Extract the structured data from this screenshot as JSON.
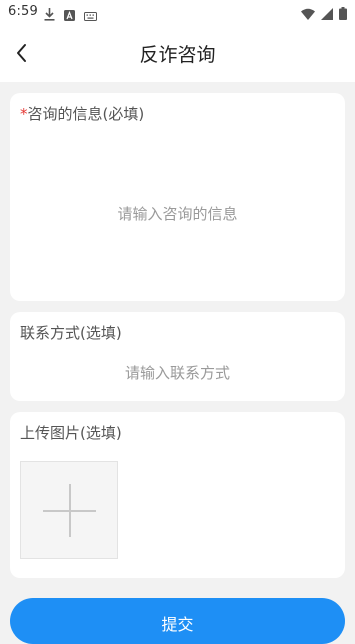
{
  "status_bar": {
    "time": "6:59",
    "icons": [
      "download-icon",
      "text-a-icon",
      "keyboard-icon",
      "wifi-icon",
      "signal-icon",
      "battery-icon"
    ]
  },
  "header": {
    "back_icon": "chevron-left-icon",
    "title": "反诈咨询"
  },
  "form": {
    "info": {
      "required_mark": "*",
      "label": "咨询的信息(必填)",
      "placeholder": "请输入咨询的信息",
      "value": ""
    },
    "contact": {
      "label": "联系方式(选填)",
      "placeholder": "请输入联系方式",
      "value": ""
    },
    "images": {
      "label": "上传图片(选填)",
      "add_icon": "plus-icon"
    }
  },
  "submit": {
    "label": "提交"
  },
  "colors": {
    "accent": "#1e8ff5",
    "required": "#e53935",
    "background": "#f2f2f2"
  }
}
